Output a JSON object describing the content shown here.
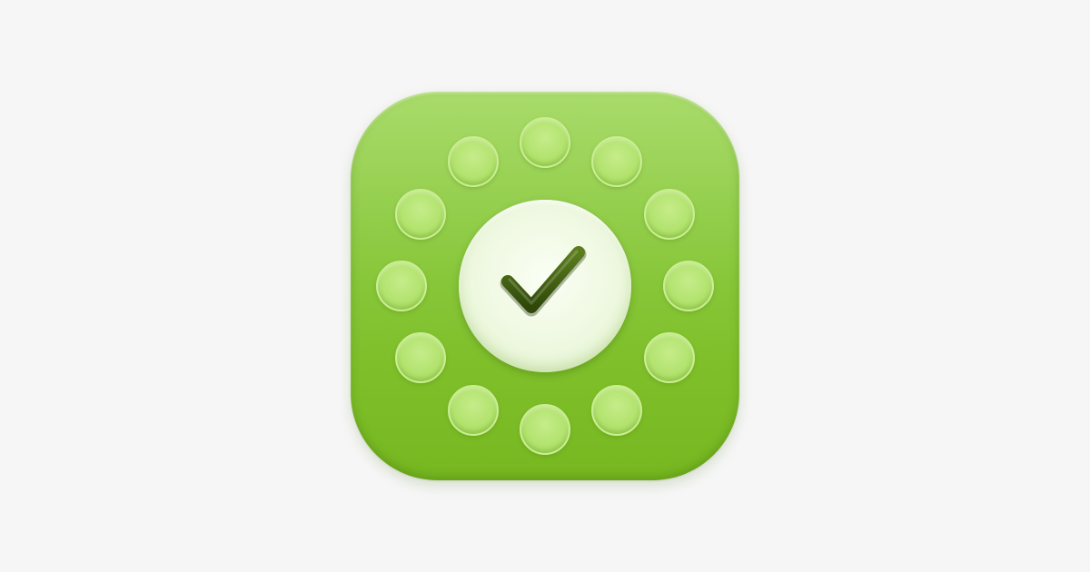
{
  "image": {
    "subject": "app-icon",
    "icons": [
      "checkmark-icon",
      "dot-ring"
    ],
    "colors": {
      "background": "#f6f6f6",
      "tile_top": "#9fd75a",
      "tile_bottom": "#77b821",
      "dot": "#b3e36f",
      "disc": "#eef8e0",
      "checkmark": "#3f5c12"
    },
    "dot_count": 12
  }
}
